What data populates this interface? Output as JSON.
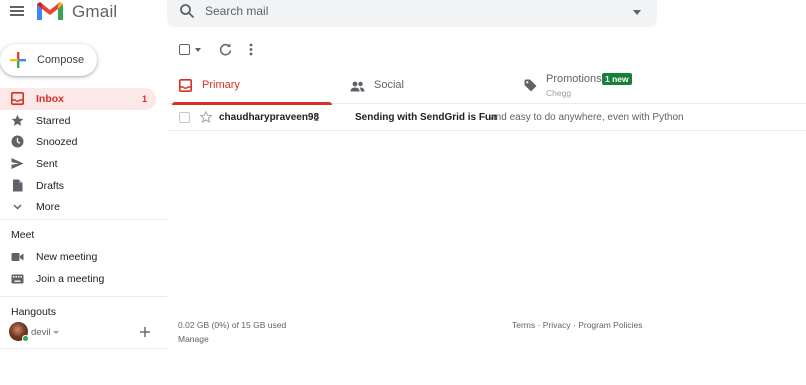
{
  "app": {
    "logo_text": "Gmail"
  },
  "search": {
    "placeholder": "Search mail"
  },
  "compose": {
    "label": "Compose"
  },
  "sidebar": {
    "items": [
      {
        "label": "Inbox",
        "count": "1",
        "icon": "inbox-icon"
      },
      {
        "label": "Starred",
        "icon": "star-icon"
      },
      {
        "label": "Snoozed",
        "icon": "clock-icon"
      },
      {
        "label": "Sent",
        "icon": "send-icon"
      },
      {
        "label": "Drafts",
        "icon": "draft-icon"
      },
      {
        "label": "More",
        "icon": "chevron-down-icon"
      }
    ]
  },
  "meet": {
    "title": "Meet",
    "items": [
      {
        "label": "New meeting",
        "icon": "video-camera-icon"
      },
      {
        "label": "Join a meeting",
        "icon": "keyboard-icon"
      }
    ]
  },
  "hangouts": {
    "title": "Hangouts",
    "user": "devil"
  },
  "tabs": {
    "primary": "Primary",
    "social": "Social",
    "promotions": "Promotions",
    "promotions_badge": "1 new",
    "promotions_sub": "Chegg"
  },
  "emails": [
    {
      "sender": "chaudharypraveen98",
      "count": "2",
      "subject": "Sending with SendGrid is Fun",
      "snippet": "- and easy to do anywhere, even with Python"
    }
  ],
  "footer": {
    "storage": "0.02 GB (0%) of 15 GB used",
    "manage": "Manage",
    "terms": "Terms",
    "privacy": "Privacy",
    "policies": "Program Policies",
    "separator": "·"
  },
  "colors": {
    "accent_red": "#d93025",
    "active_bg": "#fce8e6",
    "badge_green": "#188038"
  }
}
